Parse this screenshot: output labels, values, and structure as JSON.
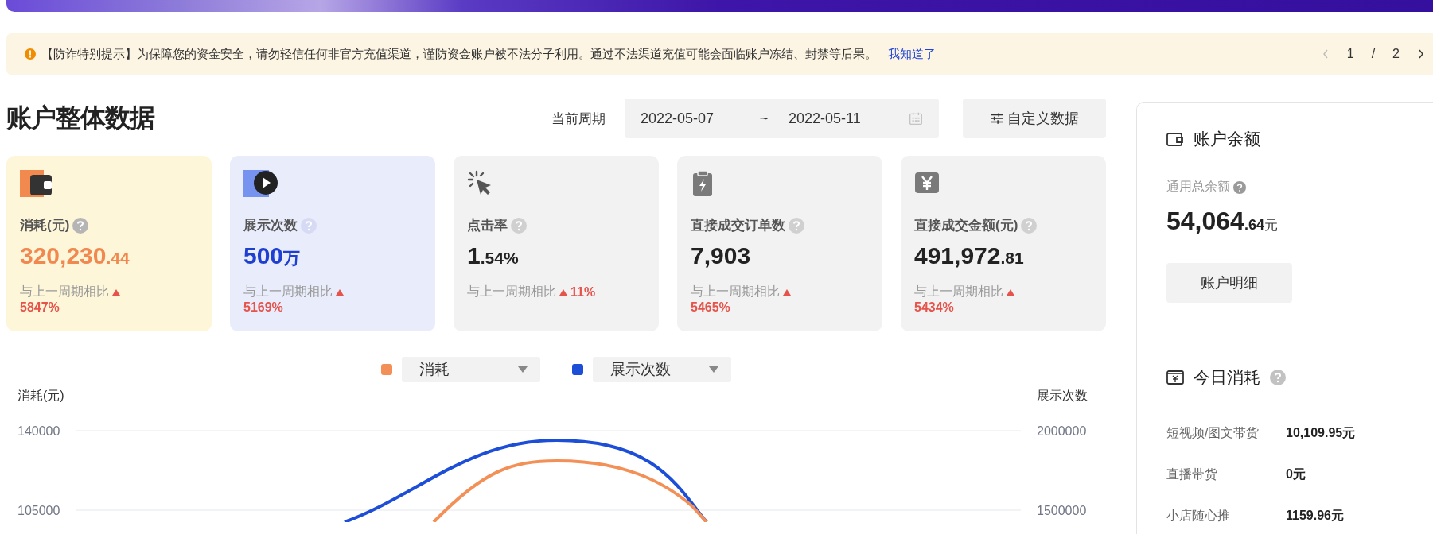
{
  "notice": {
    "text": "【防诈特别提示】为保障您的资金安全，请勿轻信任何非官方充值渠道，谨防资金账户被不法分子利用。通过不法渠道充值可能会面临账户冻结、封禁等后果。",
    "link": "我知道了",
    "page": "1",
    "separator": "/",
    "pages": "2"
  },
  "header": {
    "title": "账户整体数据",
    "period_label": "当前周期",
    "start_date": "2022-05-07",
    "range_sep": "~",
    "end_date": "2022-05-11",
    "custom_button": "自定义数据"
  },
  "cards": [
    {
      "kind": "spend",
      "label": "消耗(元)",
      "value": "320,230",
      "value_suffix": ".44",
      "compare": "与上一周期相比",
      "rising": true,
      "change": "5847%"
    },
    {
      "kind": "impressions",
      "label": "展示次数",
      "value": "500",
      "value_suffix": "万",
      "compare": "与上一周期相比",
      "rising": true,
      "change": "5169%"
    },
    {
      "kind": "ctr",
      "label": "点击率",
      "value": "1",
      "value_suffix": ".54%",
      "compare": "与上一周期相比",
      "rising": true,
      "change": "11%"
    },
    {
      "kind": "orders",
      "label": "直接成交订单数",
      "value": "7,903",
      "compare": "与上一周期相比",
      "rising": true,
      "change": "5465%"
    },
    {
      "kind": "gmv",
      "label": "直接成交金额(元)",
      "value": "491,972",
      "value_suffix": ".81",
      "compare": "与上一周期相比",
      "rising": true,
      "change": "5434%"
    }
  ],
  "chart": {
    "legend": [
      {
        "label": "消耗",
        "color": "#f39058"
      },
      {
        "label": "展示次数",
        "color": "#1d4ed8"
      }
    ],
    "left_axis_title": "消耗(元)",
    "right_axis_title": "展示次数",
    "left_ticks": [
      "140000",
      "105000"
    ],
    "right_ticks": [
      "2000000",
      "1500000"
    ]
  },
  "balance": {
    "title": "账户余额",
    "label": "通用总余额",
    "amount": "54,064",
    "decimals": ".64",
    "unit": "元",
    "button": "账户明细"
  },
  "today": {
    "title": "今日消耗",
    "rows": [
      {
        "label": "短视频/图文带货",
        "value": "10,109.95元"
      },
      {
        "label": "直播带货",
        "value": "0元"
      },
      {
        "label": "小店随心推",
        "value": "1159.96元"
      }
    ]
  }
}
